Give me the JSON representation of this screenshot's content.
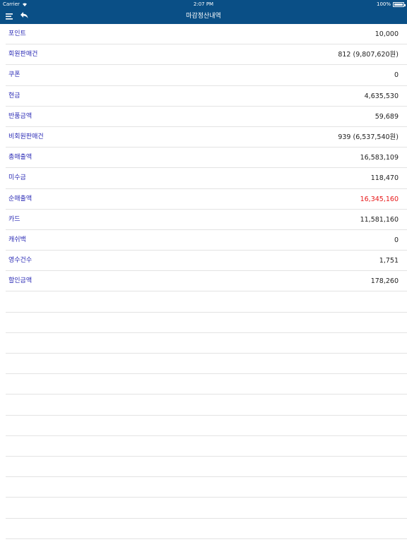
{
  "status": {
    "carrier": "Carrier",
    "time": "2:07 PM",
    "battery": "100%"
  },
  "nav": {
    "title": "마감정산내역"
  },
  "rows": [
    {
      "label": "포인트",
      "value": "10,000"
    },
    {
      "label": "회원판매건",
      "value": "812 (9,807,620원)"
    },
    {
      "label": "쿠폰",
      "value": "0"
    },
    {
      "label": "현금",
      "value": "4,635,530"
    },
    {
      "label": "반품금액",
      "value": "59,689"
    },
    {
      "label": "비회원판매건",
      "value": "939 (6,537,540원)"
    },
    {
      "label": "총매출액",
      "value": "16,583,109"
    },
    {
      "label": "미수금",
      "value": "118,470"
    },
    {
      "label": "순매출액",
      "value": "16,345,160"
    },
    {
      "label": "카드",
      "value": "11,581,160"
    },
    {
      "label": "캐쉬백",
      "value": "0"
    },
    {
      "label": "영수건수",
      "value": "1,751"
    },
    {
      "label": "할인금액",
      "value": "178,260"
    }
  ],
  "colors": {
    "header": "#0a4f86",
    "label": "#2a2ab5",
    "highlight": "#e8191a"
  }
}
